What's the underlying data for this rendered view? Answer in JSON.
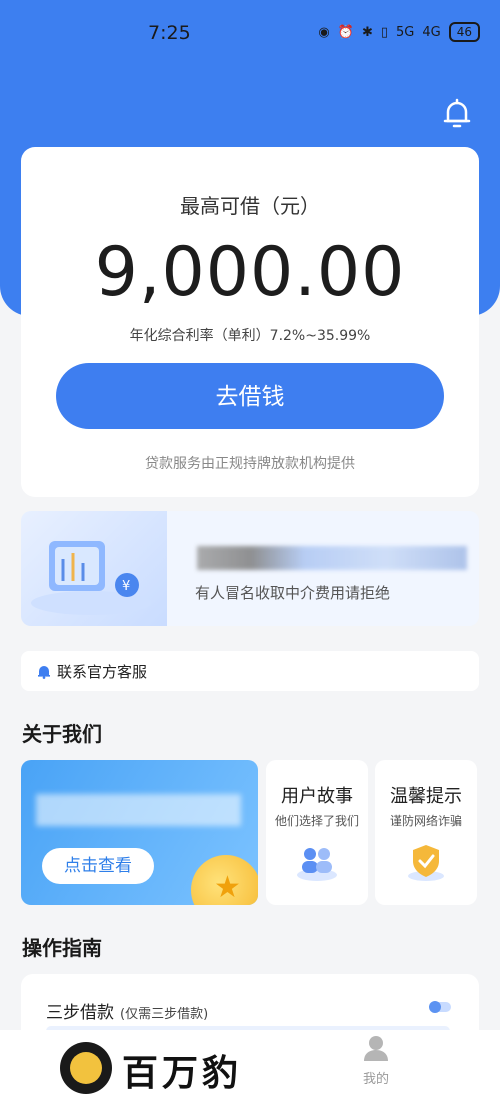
{
  "statusbar": {
    "time": "7:25",
    "signal1": "5G",
    "signal2": "4G",
    "battery": "46"
  },
  "loan": {
    "max_label": "最高可借（元）",
    "amount": "9,000.00",
    "rate_text": "年化综合利率（单利）7.2%~35.99%",
    "borrow_button": "去借钱",
    "provider_text": "贷款服务由正规持牌放款机构提供"
  },
  "banner": {
    "notice": "有人冒名收取中介费用请拒绝"
  },
  "customer_service": {
    "label": "联系官方客服"
  },
  "about": {
    "title": "关于我们",
    "view_button": "点击查看",
    "cards": [
      {
        "title": "用户故事",
        "subtitle": "他们选择了我们"
      },
      {
        "title": "温馨提示",
        "subtitle": "谨防网络诈骗"
      }
    ]
  },
  "guide": {
    "title": "操作指南",
    "step_title": "三步借款",
    "step_sub": "(仅需三步借款)"
  },
  "bottom_nav": {
    "brand": "百万豹",
    "me_label": "我的"
  },
  "colors": {
    "primary": "#3e7ef0",
    "background": "#f4f5f7"
  }
}
